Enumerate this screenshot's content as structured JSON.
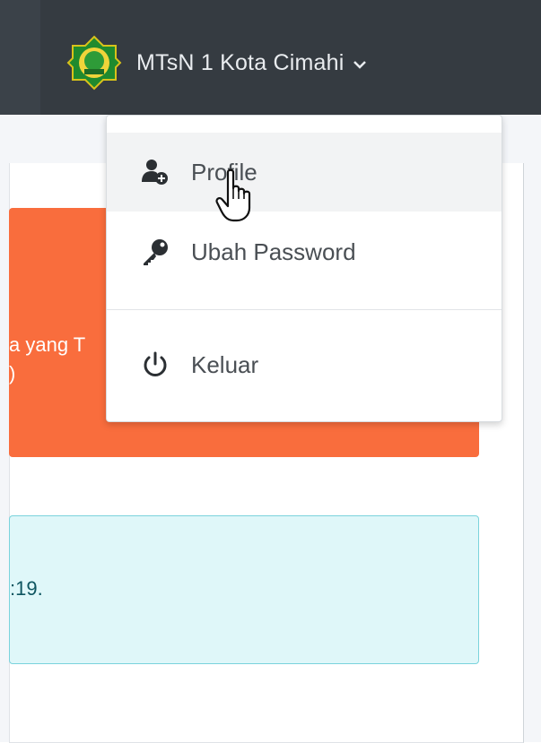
{
  "header": {
    "user_name": "MTsN 1 Kota Cimahi",
    "caret_icon": "chevron-down-icon"
  },
  "dropdown": {
    "items": [
      {
        "label": "Profile",
        "icon": "user-plus-icon"
      },
      {
        "label": "Ubah Password",
        "icon": "key-icon"
      },
      {
        "label": "Keluar",
        "icon": "power-icon"
      }
    ]
  },
  "alerts": {
    "warning_text": "a yang T",
    "warning_text_line2": ")",
    "info_text": ":19."
  },
  "colors": {
    "topbar": "#353b41",
    "warning": "#f96d3d",
    "info_bg": "#dff7f9",
    "info_border": "#7ad3dc"
  }
}
